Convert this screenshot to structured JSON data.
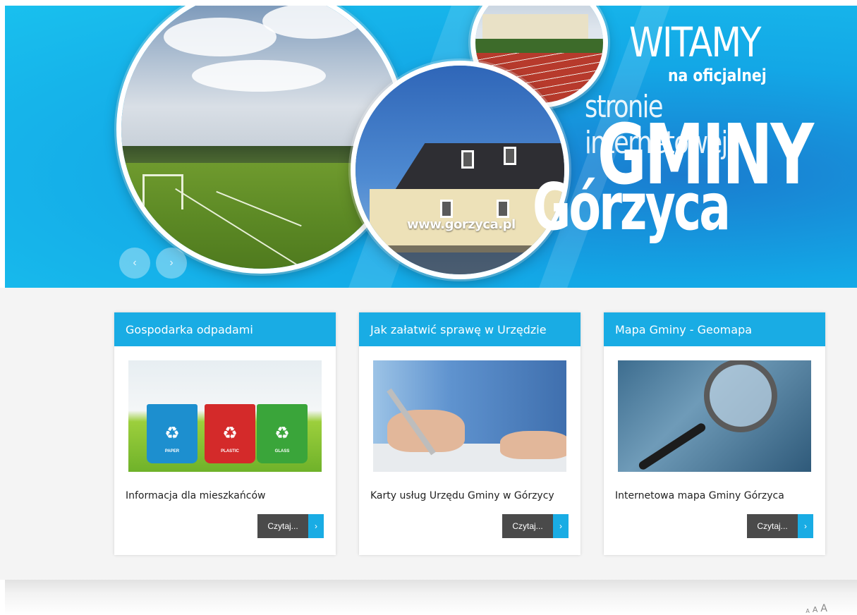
{
  "hero": {
    "line1": "WITAMY",
    "line2": "na oficjalnej",
    "line3": "stronie internetowej",
    "line4": "GMINY",
    "line5": "Górzyca",
    "url": "www.gorzyca.pl",
    "prev_icon": "‹",
    "next_icon": "›",
    "accent": "#19ace4"
  },
  "cards": [
    {
      "title": "Gospodarka odpadami",
      "desc": "Informacja dla mieszkańców",
      "button": "Czytaj...",
      "button_icon": "›"
    },
    {
      "title": "Jak załatwić sprawę w Urzędzie",
      "desc": "Karty usług Urzędu Gminy w Górzycy",
      "button": "Czytaj...",
      "button_icon": "›"
    },
    {
      "title": "Mapa Gminy - Geomapa",
      "desc": "Internetowa mapa Gminy Górzyca",
      "button": "Czytaj...",
      "button_icon": "›"
    }
  ],
  "recycle_bins": [
    {
      "label": "PAPER",
      "symbol": "♻"
    },
    {
      "label": "PLASTIC",
      "symbol": "♻"
    },
    {
      "label": "GLASS",
      "symbol": "♻"
    }
  ],
  "font_size_controls": {
    "small": "A",
    "medium": "A",
    "large": "A"
  }
}
